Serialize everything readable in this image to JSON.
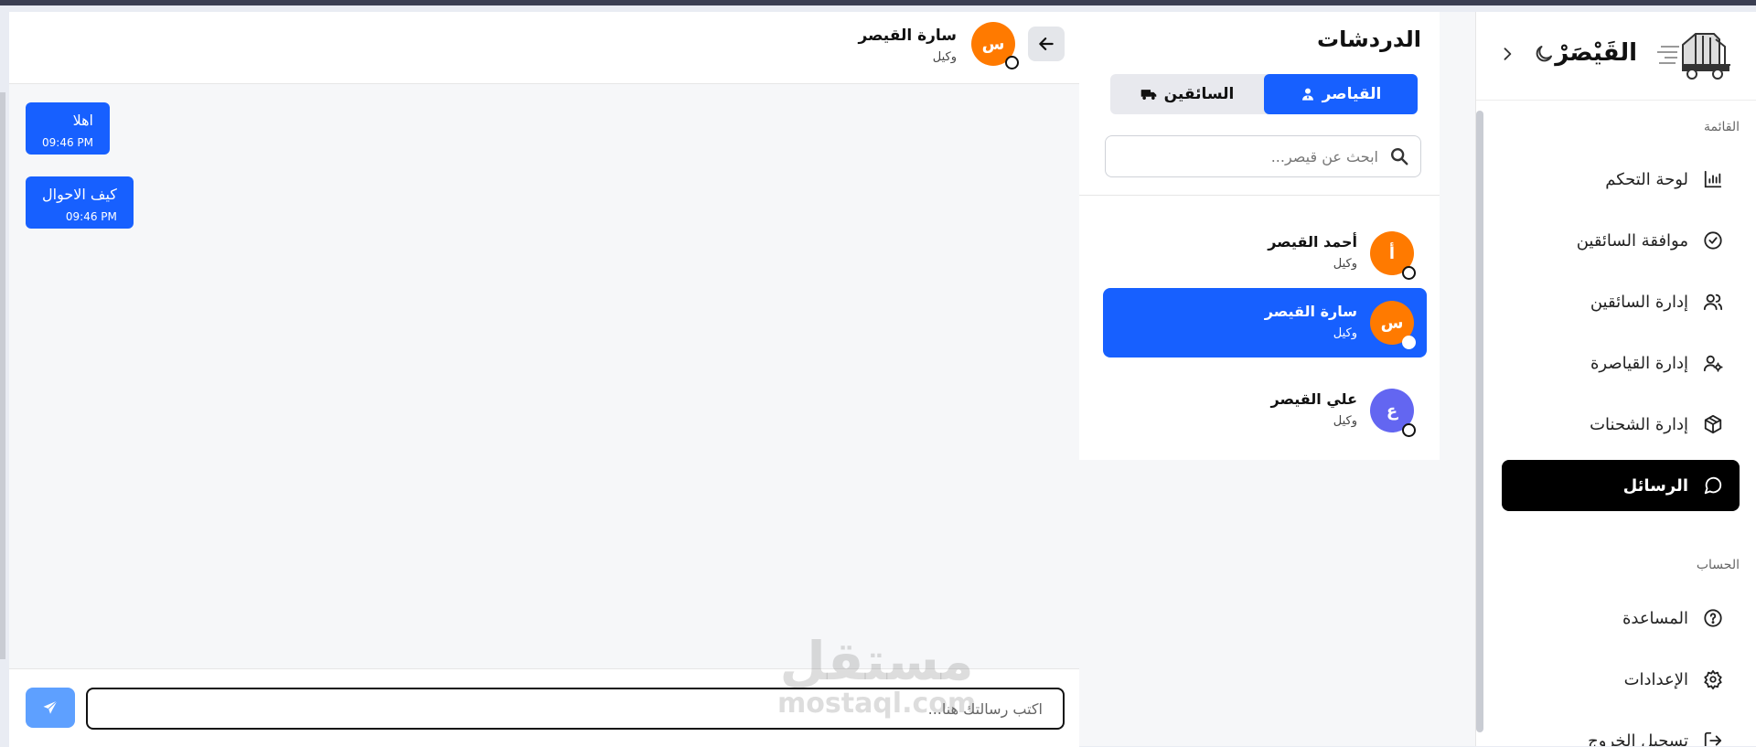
{
  "app": {
    "brand": "القَيْصَرْ"
  },
  "sidebar": {
    "section_menu": "القائمة",
    "section_account": "الحساب",
    "items": [
      {
        "label": "لوحة التحكم",
        "icon": "bar-chart-icon"
      },
      {
        "label": "موافقة السائقين",
        "icon": "check-circle-icon"
      },
      {
        "label": "إدارة السائقين",
        "icon": "users-icon"
      },
      {
        "label": "إدارة القياصرة",
        "icon": "user-cog-icon"
      },
      {
        "label": "إدارة الشحنات",
        "icon": "package-icon"
      },
      {
        "label": "الرسائل",
        "icon": "message-circle-icon",
        "active": true
      }
    ],
    "account_items": [
      {
        "label": "المساعدة",
        "icon": "help-circle-icon"
      },
      {
        "label": "الإعدادات",
        "icon": "gear-icon"
      },
      {
        "label": "تسجيل الخروج",
        "icon": "logout-icon"
      }
    ]
  },
  "chats": {
    "title": "الدردشات",
    "tabs": [
      {
        "label": "القياصر",
        "icon": "user-tie-icon",
        "active": true
      },
      {
        "label": "السائقين",
        "icon": "truck-icon",
        "active": false
      }
    ],
    "search_placeholder": "ابحث عن قيصر...",
    "conversations": [
      {
        "initial": "أ",
        "name": "أحمد القيصر",
        "role": "وكيل",
        "color": "#ff7a00",
        "selected": false
      },
      {
        "initial": "س",
        "name": "سارة القيصر",
        "role": "وكيل",
        "color": "#ff7a00",
        "selected": true
      },
      {
        "initial": "ع",
        "name": "علي القيصر",
        "role": "وكيل",
        "color": "#6366f1",
        "selected": false
      }
    ]
  },
  "chat_window": {
    "contact_initial": "س",
    "contact_name": "سارة القيصر",
    "contact_role": "وكيل",
    "messages": [
      {
        "text": "اهلا",
        "time": "09:46 PM"
      },
      {
        "text": "كيف الاحوال",
        "time": "09:46 PM"
      }
    ],
    "input_placeholder": "اكتب رسالتك هنا..."
  },
  "watermark": {
    "line1": "مستقل",
    "line2": "mostaql.com"
  },
  "colors": {
    "primary": "#1760ff",
    "active_nav": "#000000",
    "avatar_orange": "#ff7a00",
    "avatar_purple": "#6366f1"
  }
}
